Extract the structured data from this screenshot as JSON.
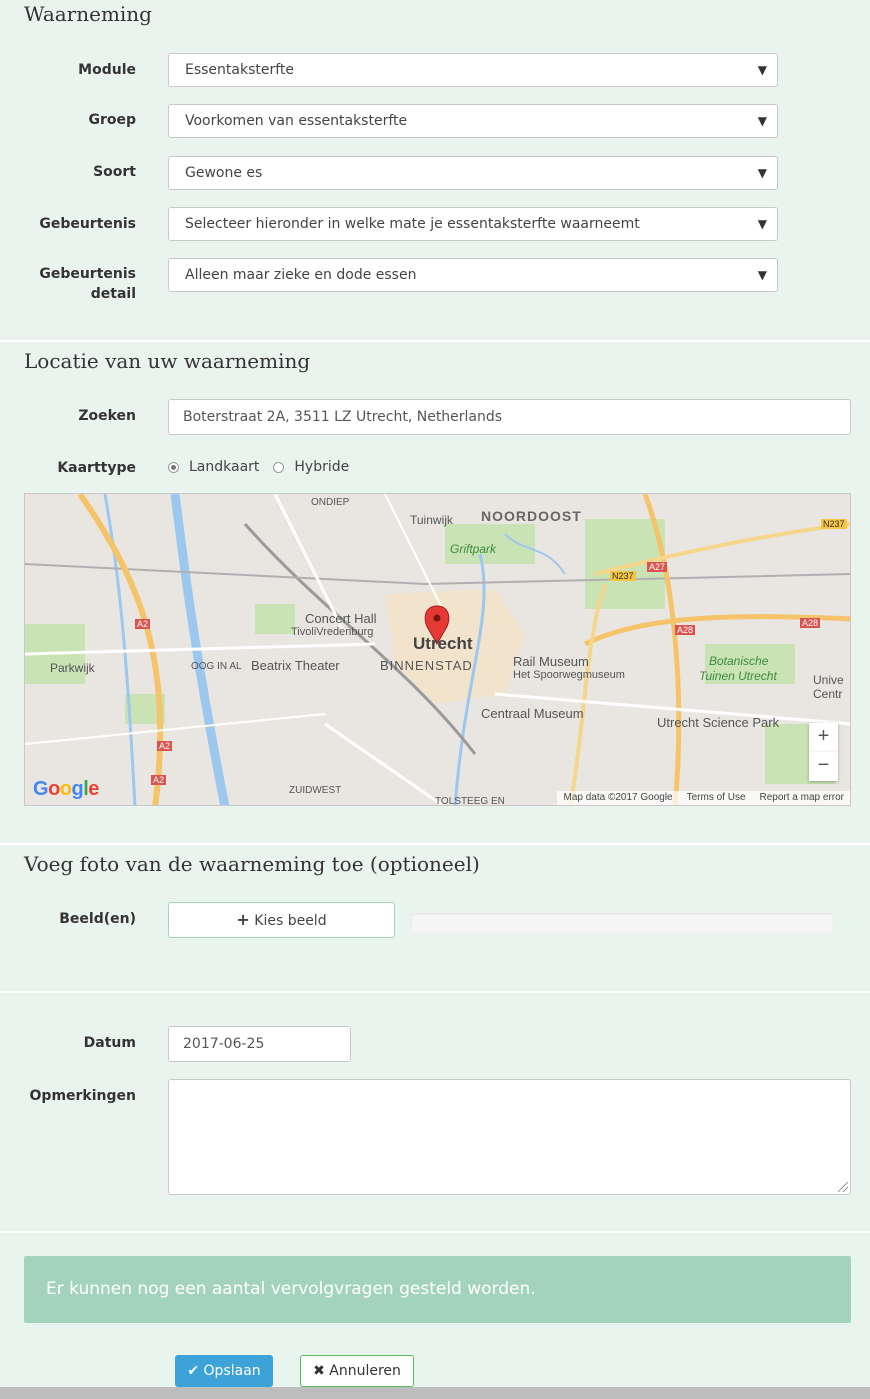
{
  "sections": {
    "observation": "Waarneming",
    "location": "Locatie van uw waarneming",
    "photo": "Voeg foto van de waarneming toe (optioneel)"
  },
  "fields": {
    "module": {
      "label": "Module",
      "value": "Essentaksterfte"
    },
    "group": {
      "label": "Groep",
      "value": "Voorkomen van essentaksterfte"
    },
    "species": {
      "label": "Soort",
      "value": "Gewone es"
    },
    "event": {
      "label": "Gebeurtenis",
      "value": "Selecteer hieronder in welke mate je essentaksterfte waarneemt"
    },
    "event_detail": {
      "label_line1": "Gebeurtenis",
      "label_line2": "detail",
      "value": "Alleen maar zieke en dode essen"
    },
    "search": {
      "label": "Zoeken",
      "value": "Boterstraat 2A, 3511 LZ Utrecht, Netherlands"
    },
    "map_type": {
      "label": "Kaarttype",
      "options": [
        "Landkaart",
        "Hybride"
      ],
      "selected": "Landkaart"
    },
    "images": {
      "label": "Beeld(en)",
      "button": "Kies beeld",
      "progress": 0
    },
    "date": {
      "label": "Datum",
      "value": "2017-06-25"
    },
    "remarks": {
      "label": "Opmerkingen",
      "value": ""
    }
  },
  "map": {
    "labels": {
      "noordoost": "NOORDOOST",
      "tuinwijk": "Tuinwijk",
      "ondiep": "ONDIEP",
      "griftpark": "Griftpark",
      "concert_hall": "Concert Hall",
      "tivoli": "TivoliVredenburg",
      "utrecht": "Utrecht",
      "binnenstad": "BINNENSTAD",
      "rail_museum": "Rail Museum",
      "spoorweg": "Het Spoorwegmuseum",
      "beatrix": "Beatrix Theater",
      "oog_in_al": "OOG IN AL",
      "parkwijk": "Parkwijk",
      "centraal_museum": "Centraal Museum",
      "botanische1": "Botanische",
      "botanische2": "Tuinen Utrecht",
      "science_park": "Utrecht Science Park",
      "univ1": "Unive",
      "univ2": "Centr",
      "zuidwest": "ZUIDWEST",
      "tolsteeg": "TOLSTEEG EN",
      "a2_1": "A2",
      "a2_2": "A2",
      "a2_3": "A2",
      "a27": "A27",
      "a28_1": "A28",
      "a28_2": "A28",
      "n237_1": "N237",
      "n237_2": "N237"
    },
    "zoom_in": "+",
    "zoom_out": "−",
    "footer": {
      "data": "Map data ©2017 Google",
      "terms": "Terms of Use",
      "report": "Report a map error"
    },
    "logo": "Google"
  },
  "alert": "Er kunnen nog een aantal vervolgvragen gesteld worden.",
  "buttons": {
    "save": "Opslaan",
    "cancel": "Annuleren"
  },
  "icons": {
    "caret": "caret-down-icon",
    "plus": "plus-icon",
    "check": "check-icon",
    "times": "times-icon",
    "marker": "map-marker-icon"
  },
  "colors": {
    "background": "#eaf4ee",
    "alert": "#a3d4bb",
    "primary": "#3ca2d8",
    "cancel_border": "#5cb85c"
  }
}
